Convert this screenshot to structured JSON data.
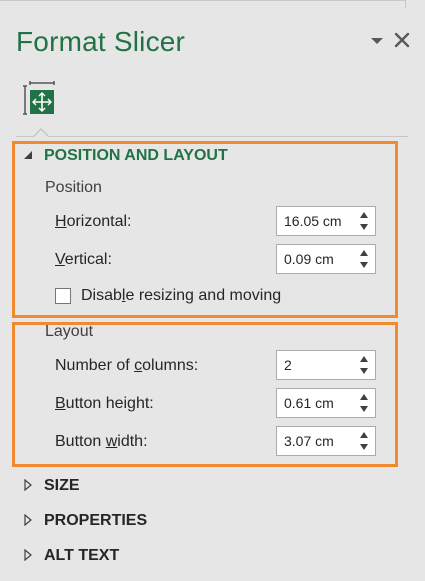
{
  "pane": {
    "title": "Format Slicer",
    "menu_icon": "chevron-down-icon",
    "close_icon": "close-icon",
    "tab_icon": "size-properties-icon"
  },
  "sections": {
    "position_layout": {
      "label": "POSITION AND LAYOUT",
      "expanded": true,
      "position_group": {
        "label": "Position",
        "horizontal": {
          "pre": "",
          "mnemonic": "H",
          "post": "orizontal:",
          "value": "16.05 cm"
        },
        "vertical": {
          "pre": "",
          "mnemonic": "V",
          "post": "ertical:",
          "value": "0.09 cm"
        },
        "disable_resize": {
          "pre": "Disab",
          "mnemonic": "l",
          "post": "e resizing and moving",
          "checked": false
        }
      },
      "layout_group": {
        "label": "Layout",
        "columns": {
          "pre": "Number of ",
          "mnemonic": "c",
          "post": "olumns:",
          "value": "2"
        },
        "button_height": {
          "pre": "",
          "mnemonic": "B",
          "post": "utton height:",
          "value": "0.61 cm"
        },
        "button_width": {
          "pre": "Button ",
          "mnemonic": "w",
          "post": "idth:",
          "value": "3.07 cm"
        }
      }
    },
    "size": {
      "label": "SIZE",
      "expanded": false
    },
    "properties": {
      "label": "PROPERTIES",
      "expanded": false
    },
    "alt_text": {
      "label": "ALT TEXT",
      "expanded": false
    }
  },
  "colors": {
    "accent": "#217346",
    "highlight": "#f08a2e",
    "background": "#e6e6e6"
  }
}
